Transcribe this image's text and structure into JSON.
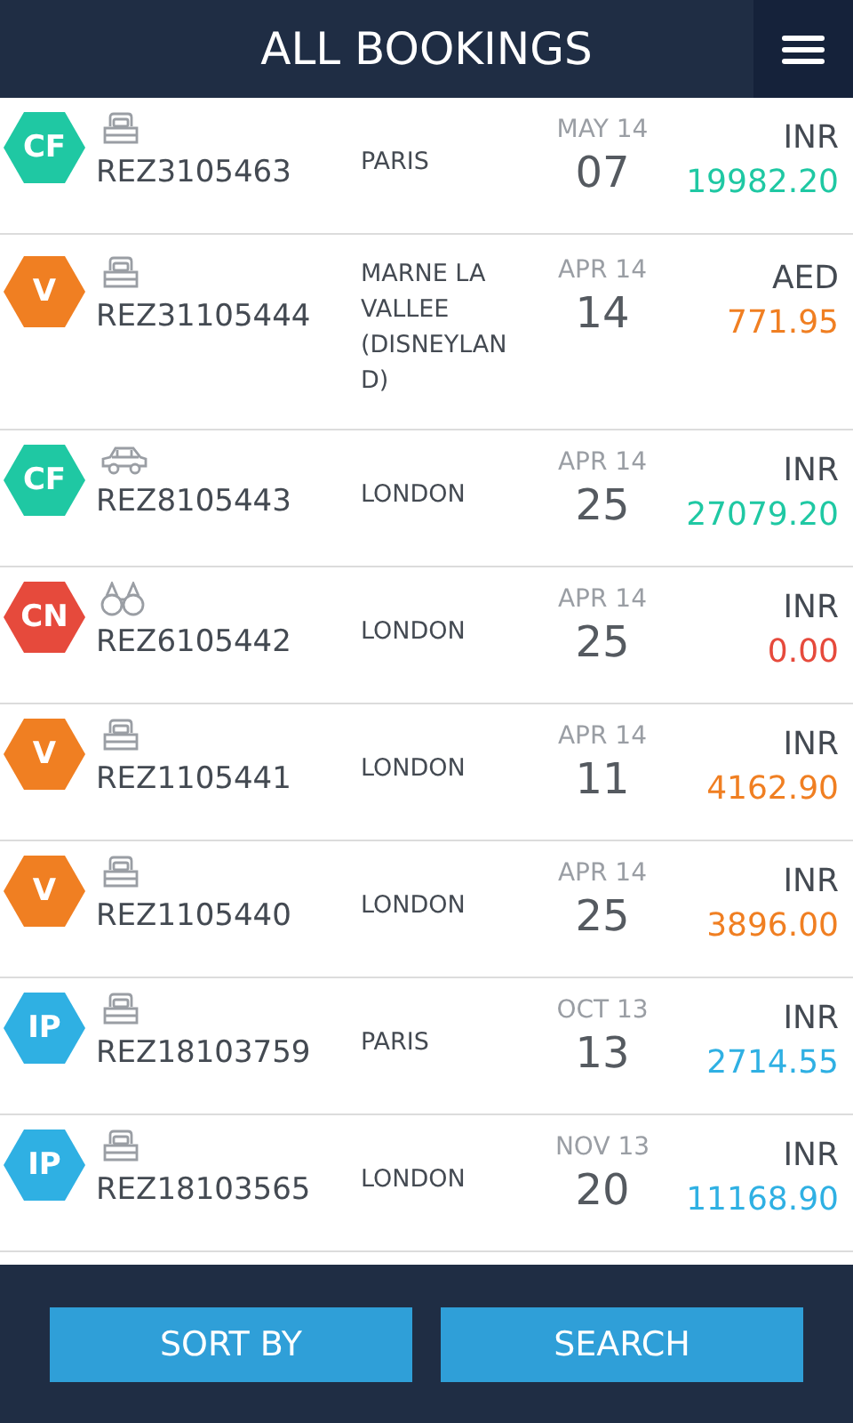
{
  "header": {
    "title": "ALL BOOKINGS"
  },
  "bookings": [
    {
      "status": "CF",
      "color": "#1fc8a3",
      "kind": "hotel",
      "ref": "REZ3105463",
      "city": "PARIS",
      "month": "MAY 14",
      "day": "07",
      "currency": "INR",
      "amount": "19982.20"
    },
    {
      "status": "V",
      "color": "#f07f22",
      "kind": "hotel",
      "ref": "REZ31105444",
      "city": "MARNE LA VALLEE (DISNEYLAN D)",
      "month": "APR 14",
      "day": "14",
      "currency": "AED",
      "amount": "771.95"
    },
    {
      "status": "CF",
      "color": "#1fc8a3",
      "kind": "car",
      "ref": "REZ8105443",
      "city": "LONDON",
      "month": "APR 14",
      "day": "25",
      "currency": "INR",
      "amount": "27079.20"
    },
    {
      "status": "CN",
      "color": "#e64a3c",
      "kind": "sightseeing",
      "ref": "REZ6105442",
      "city": "LONDON",
      "month": "APR 14",
      "day": "25",
      "currency": "INR",
      "amount": "0.00"
    },
    {
      "status": "V",
      "color": "#f07f22",
      "kind": "hotel",
      "ref": "REZ1105441",
      "city": "LONDON",
      "month": "APR 14",
      "day": "11",
      "currency": "INR",
      "amount": "4162.90"
    },
    {
      "status": "V",
      "color": "#f07f22",
      "kind": "hotel",
      "ref": "REZ1105440",
      "city": "LONDON",
      "month": "APR 14",
      "day": "25",
      "currency": "INR",
      "amount": "3896.00"
    },
    {
      "status": "IP",
      "color": "#2fb0e3",
      "kind": "hotel",
      "ref": "REZ18103759",
      "city": "PARIS",
      "month": "OCT 13",
      "day": "13",
      "currency": "INR",
      "amount": "2714.55"
    },
    {
      "status": "IP",
      "color": "#2fb0e3",
      "kind": "hotel",
      "ref": "REZ18103565",
      "city": "LONDON",
      "month": "NOV 13",
      "day": "20",
      "currency": "INR",
      "amount": "11168.90"
    }
  ],
  "footer": {
    "buttons": [
      "SORT BY",
      "SEARCH"
    ]
  }
}
